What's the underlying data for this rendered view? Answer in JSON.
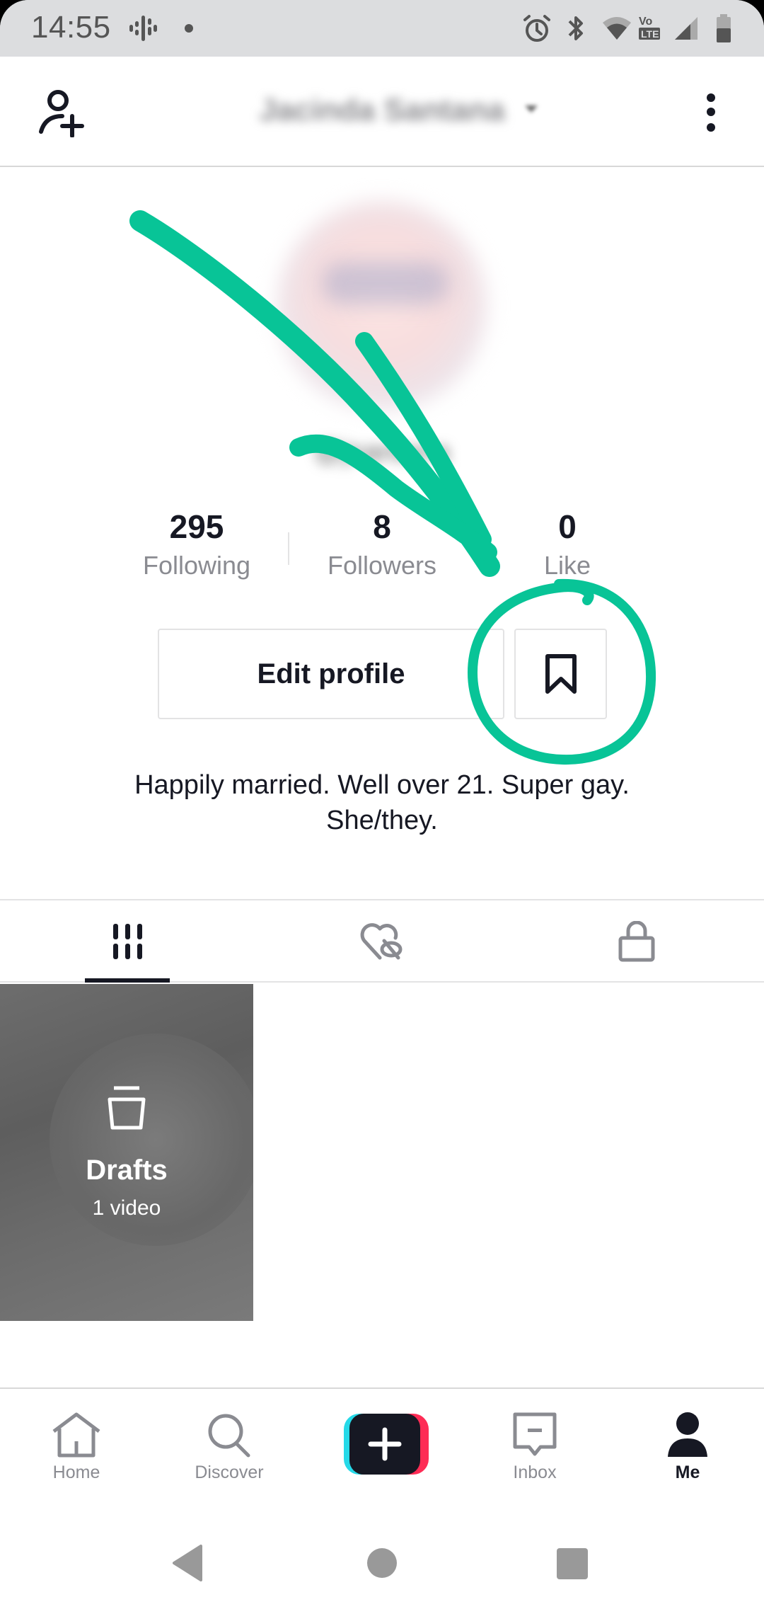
{
  "status_bar": {
    "time": "14:55",
    "icons": [
      "podcast-icon",
      "dot-icon",
      "alarm-icon",
      "bluetooth-icon",
      "wifi-icon",
      "volte-icon",
      "signal-icon",
      "battery-icon"
    ]
  },
  "header": {
    "add_friend_icon": "person-add-icon",
    "username": "Jacinda Santana",
    "username_blurred": true,
    "menu_icon": "more-vertical-icon"
  },
  "profile": {
    "handle": "@jsantana",
    "handle_blurred": true,
    "stats": [
      {
        "value": "295",
        "label": "Following"
      },
      {
        "value": "8",
        "label": "Followers"
      },
      {
        "value": "0",
        "label": "Like"
      }
    ],
    "edit_profile_label": "Edit profile",
    "bookmark_icon": "bookmark-icon",
    "bio_line1": "Happily married. Well over 21. Super gay.",
    "bio_line2": "She/they."
  },
  "tabs": [
    {
      "name": "videos",
      "icon": "grid-icon",
      "active": true
    },
    {
      "name": "liked",
      "icon": "heart-hidden-icon",
      "active": false
    },
    {
      "name": "private",
      "icon": "lock-icon",
      "active": false
    }
  ],
  "grid": {
    "drafts": {
      "title": "Drafts",
      "subtitle": "1 video",
      "icon": "drafts-icon"
    }
  },
  "bottom_nav": [
    {
      "label": "Home",
      "icon": "home-icon",
      "active": false
    },
    {
      "label": "Discover",
      "icon": "search-icon",
      "active": false
    },
    {
      "label": "",
      "icon": "create-plus-icon",
      "active": false
    },
    {
      "label": "Inbox",
      "icon": "inbox-icon",
      "active": false
    },
    {
      "label": "Me",
      "icon": "profile-icon",
      "active": true
    }
  ],
  "system_nav": [
    "back-icon",
    "home-circle-icon",
    "recents-icon"
  ],
  "annotation": {
    "color": "#08c497",
    "target": "bookmark-button",
    "type": "arrow-and-circle"
  },
  "colors": {
    "text_primary": "#161823",
    "text_secondary": "#8a8b91",
    "divider": "#e3e3e4",
    "create_cyan": "#25d9e8",
    "create_pink": "#fe2c55"
  }
}
